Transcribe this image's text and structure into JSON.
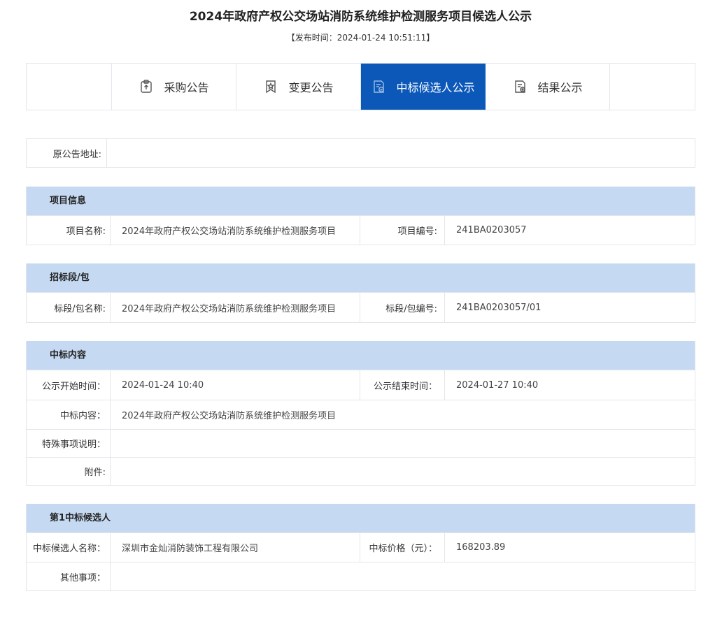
{
  "header": {
    "title": "2024年政府产权公交场站消防系统维护检测服务项目候选人公示",
    "publish_time": "【发布时间：2024-01-24 10:51:11】"
  },
  "tabs": [
    {
      "label": "采购公告",
      "icon": "clipboard-upload-icon",
      "active": false
    },
    {
      "label": "变更公告",
      "icon": "bookmark-star-icon",
      "active": false
    },
    {
      "label": "中标候选人公示",
      "icon": "document-check-icon",
      "active": true
    },
    {
      "label": "结果公示",
      "icon": "document-gear-icon",
      "active": false
    }
  ],
  "original": {
    "label": "原公告地址:",
    "value": ""
  },
  "project_info": {
    "heading": "项目信息",
    "name_label": "项目名称:",
    "name_value": "2024年政府产权公交场站消防系统维护检测服务项目",
    "code_label": "项目编号:",
    "code_value": "241BA0203057"
  },
  "package": {
    "heading": "招标段/包",
    "name_label": "标段/包名称:",
    "name_value": "2024年政府产权公交场站消防系统维护检测服务项目",
    "code_label": "标段/包编号:",
    "code_value": "241BA0203057/01"
  },
  "content": {
    "heading": "中标内容",
    "start_label": "公示开始时间：",
    "start_value": "2024-01-24 10:40",
    "end_label": "公示结束时间：",
    "end_value": "2024-01-27 10:40",
    "content_label": "中标内容：",
    "content_value": "2024年政府产权公交场站消防系统维护检测服务项目",
    "special_label": "特殊事项说明：",
    "special_value": "",
    "attach_label": "附件:",
    "attach_value": ""
  },
  "candidate": {
    "heading": "第1中标候选人",
    "name_label": "中标候选人名称：",
    "name_value": "深圳市金灿消防装饰工程有限公司",
    "price_label": "中标价格（元）：",
    "price_value": "168203.89",
    "other_label": "其他事项：",
    "other_value": ""
  },
  "colors": {
    "accent": "#0b58b9",
    "section_head": "#c5daf2",
    "border": "#e2e6eb"
  }
}
